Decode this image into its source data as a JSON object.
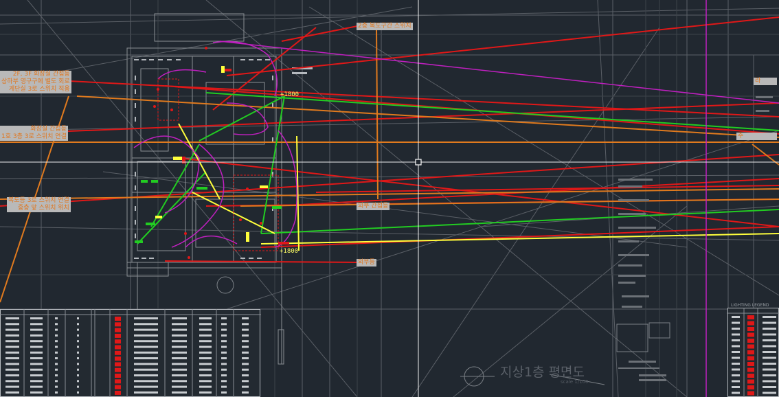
{
  "drawing": {
    "title": "지상1층 평면도",
    "scale_label": "scale 1/100",
    "legend_title": "LIGHTING LEGEND"
  },
  "annotations": [
    {
      "id": "a1",
      "lines": [
        "2층 복도구간 스위치"
      ]
    },
    {
      "id": "a2",
      "lines": [
        "2F, 3F 화장실 간접등",
        "상하부 영구구에 별도 회로",
        "게단실 3로 스위치 적용"
      ]
    },
    {
      "id": "a3",
      "lines": [
        "화장실 간접등",
        "1호 3층 3로 스위치 연결"
      ]
    },
    {
      "id": "a4",
      "lines": [
        "복도등 3로 스위치 연결",
        "중층 앞 스위치 위치"
      ]
    },
    {
      "id": "a5",
      "lines": [
        "외부 간접등"
      ]
    },
    {
      "id": "a6",
      "lines": [
        "외부등"
      ]
    },
    {
      "id": "a7",
      "lines": [
        "라"
      ]
    },
    {
      "id": "a8",
      "lines": [
        "주"
      ]
    }
  ],
  "dimensions": {
    "d1": "+1800",
    "d2": "+1800"
  },
  "colors": {
    "background": "#212830",
    "red": "#e01818",
    "green": "#22cc22",
    "yellow": "#ffff3c",
    "magenta": "#c020c0",
    "orange": "#e07a1e",
    "gray": "#6a6f75",
    "crosshair": "#f0f0f0"
  },
  "cursor": "crosshair-pickbox",
  "tables": {
    "left_rows": 14,
    "right_rows": 14
  }
}
